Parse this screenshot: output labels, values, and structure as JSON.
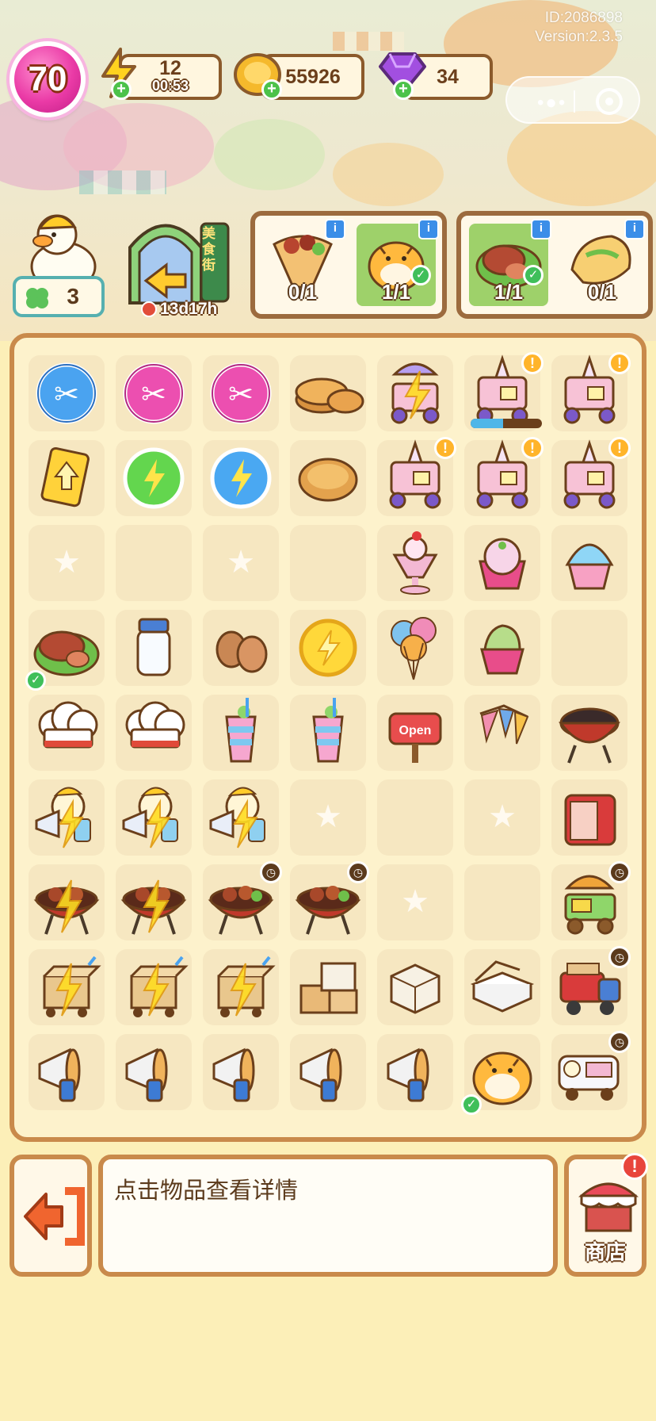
{
  "meta": {
    "user_id": "ID:2086898",
    "version": "Version:2.3.5"
  },
  "hud": {
    "level": "70",
    "energy": {
      "value": "12",
      "timer": "00:53"
    },
    "coins": "55926",
    "gems": "34"
  },
  "character": {
    "clover_count": "3"
  },
  "event": {
    "sign_text": "美食街",
    "countdown": "13d17h"
  },
  "orders": [
    {
      "slots": [
        {
          "item": "kebab-wrap",
          "count": "0/1",
          "done": false
        },
        {
          "item": "tiger-plush",
          "count": "1/1",
          "done": true
        }
      ]
    },
    {
      "slots": [
        {
          "item": "grilled-meat-platter",
          "count": "1/1",
          "done": true
        },
        {
          "item": "burrito",
          "count": "0/1",
          "done": false
        }
      ]
    }
  ],
  "board": {
    "rows": [
      [
        "blue-scissors-orb",
        "pink-scissors-orb",
        "pink-scissors-orb",
        "pancake-stack",
        "parasol-cart-charged",
        "icecream-cart",
        "icecream-cart"
      ],
      [
        "golden-upgrade-card",
        "green-energy-orb",
        "blue-energy-orb",
        "single-pancake",
        "icecream-cart",
        "icecream-cart",
        "icecream-cart"
      ],
      [
        "locked",
        "empty",
        "locked",
        "empty",
        "sundae-glass",
        "icecream-cup",
        "shaved-ice"
      ],
      [
        "grilled-meat-platter",
        "milk-bottle",
        "eggs",
        "gold-energy-coin",
        "balloons",
        "matcha-icecream",
        "empty"
      ],
      [
        "chef-hat",
        "chef-hat",
        "rainbow-drink",
        "rainbow-drink",
        "open-sign",
        "bunting-flags",
        "bbq-grill"
      ],
      [
        "duck-megaphone-charged",
        "duck-megaphone-charged",
        "duck-megaphone-charged",
        "locked",
        "empty",
        "locked",
        "red-fridge"
      ],
      [
        "bbq-skewers-charged",
        "bbq-skewers-charged",
        "bbq-skewers",
        "bbq-skewers",
        "locked",
        "empty",
        "food-cart"
      ],
      [
        "box-cart-charged",
        "box-cart-charged",
        "box-cart-charged",
        "box-stack",
        "single-box",
        "takeout-box",
        "red-truck"
      ],
      [
        "megaphone",
        "megaphone",
        "megaphone",
        "megaphone",
        "megaphone",
        "tiger-plush",
        "food-van"
      ]
    ]
  },
  "panel": {
    "hint": "点击物品查看详情",
    "shop_label": "商店"
  }
}
